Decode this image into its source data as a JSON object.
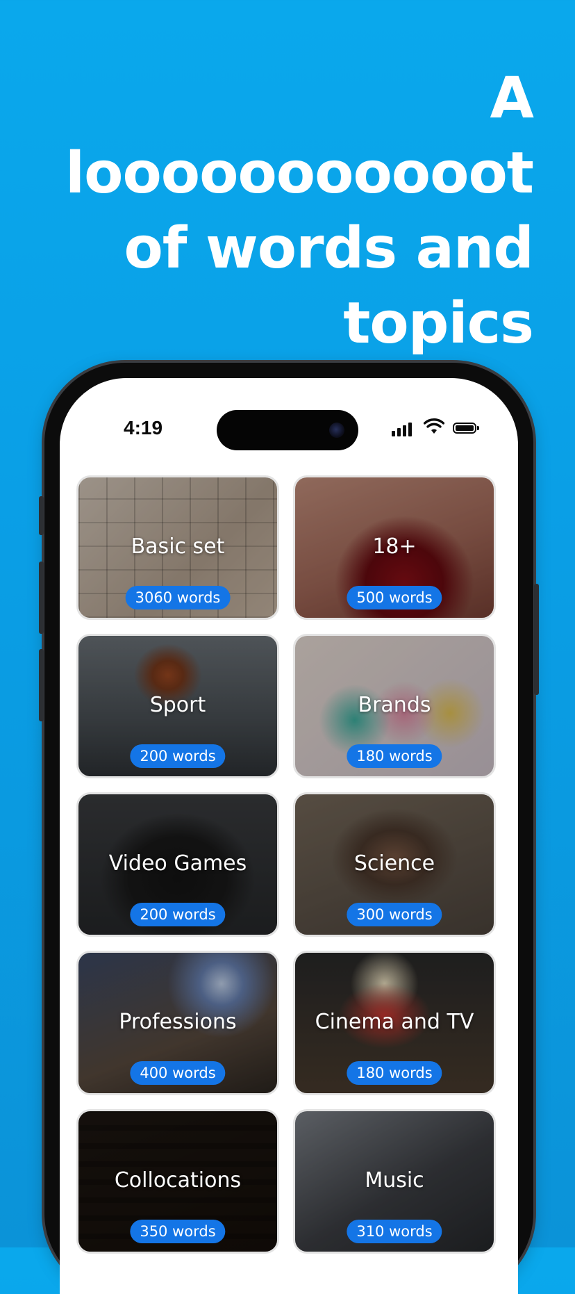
{
  "headline": [
    "A looooooooooot",
    "of words and",
    "topics"
  ],
  "status_bar": {
    "time": "4:19",
    "icons": [
      "cellular-signal-icon",
      "wifi-icon",
      "battery-icon"
    ]
  },
  "topics": [
    {
      "title": "Basic set",
      "count": "3060 words"
    },
    {
      "title": "18+",
      "count": "500 words"
    },
    {
      "title": "Sport",
      "count": "200 words"
    },
    {
      "title": "Brands",
      "count": "180 words"
    },
    {
      "title": "Video Games",
      "count": "200 words"
    },
    {
      "title": "Science",
      "count": "300 words"
    },
    {
      "title": "Professions",
      "count": "400 words"
    },
    {
      "title": "Cinema and TV",
      "count": "180 words"
    },
    {
      "title": "Collocations",
      "count": "350 words"
    },
    {
      "title": "Music",
      "count": "310 words"
    }
  ],
  "colors": {
    "background": "#0aa8ec",
    "badge": "#1475e6",
    "text_light": "#ffffff"
  }
}
